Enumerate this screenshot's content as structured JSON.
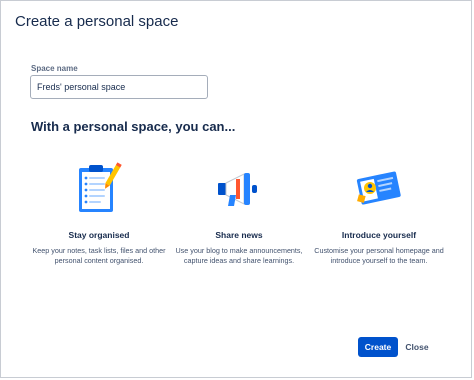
{
  "dialog": {
    "title": "Create a personal space"
  },
  "form": {
    "space_name_label": "Space name",
    "space_name_value": "Freds' personal space"
  },
  "intro": {
    "heading": "With a personal space, you can..."
  },
  "features": [
    {
      "icon": "clipboard-checklist-icon",
      "title": "Stay organised",
      "description": "Keep your notes, task lists, files and other personal content organised."
    },
    {
      "icon": "megaphone-icon",
      "title": "Share news",
      "description": "Use your blog to make announcements, capture ideas and share learnings."
    },
    {
      "icon": "profile-card-icon",
      "title": "Introduce yourself",
      "description": "Customise your personal homepage and introduce yourself to the team."
    }
  ],
  "actions": {
    "create_label": "Create",
    "close_label": "Close"
  },
  "colors": {
    "primary_button": "#0052cc",
    "heading_text": "#172b4d",
    "body_text": "#42526e",
    "illustration_blue": "#2684ff",
    "illustration_yellow": "#ffc400"
  }
}
